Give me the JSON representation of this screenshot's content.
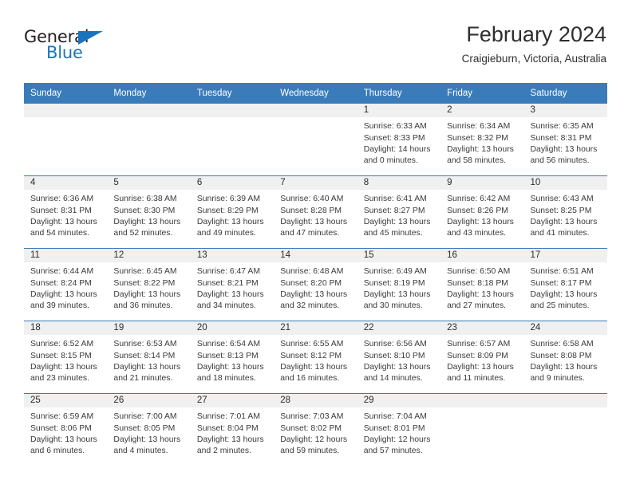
{
  "brand": {
    "name_part1": "General",
    "name_part2": "Blue",
    "triangle_color": "#1874bc"
  },
  "header": {
    "title": "February 2024",
    "subtitle": "Craigieburn, Victoria, Australia"
  },
  "theme": {
    "header_blue": "#3a7cba",
    "day_band_gray": "#f0f0f0",
    "text": "#2b2b2b"
  },
  "calendar": {
    "weekday_headers": [
      "Sunday",
      "Monday",
      "Tuesday",
      "Wednesday",
      "Thursday",
      "Friday",
      "Saturday"
    ],
    "weeks": [
      [
        {
          "day": "",
          "empty": true,
          "sunrise": "",
          "sunset": "",
          "daylight_line1": "",
          "daylight_line2": ""
        },
        {
          "day": "",
          "empty": true,
          "sunrise": "",
          "sunset": "",
          "daylight_line1": "",
          "daylight_line2": ""
        },
        {
          "day": "",
          "empty": true,
          "sunrise": "",
          "sunset": "",
          "daylight_line1": "",
          "daylight_line2": ""
        },
        {
          "day": "",
          "empty": true,
          "sunrise": "",
          "sunset": "",
          "daylight_line1": "",
          "daylight_line2": ""
        },
        {
          "day": "1",
          "empty": false,
          "sunrise": "Sunrise: 6:33 AM",
          "sunset": "Sunset: 8:33 PM",
          "daylight_line1": "Daylight: 14 hours",
          "daylight_line2": "and 0 minutes."
        },
        {
          "day": "2",
          "empty": false,
          "sunrise": "Sunrise: 6:34 AM",
          "sunset": "Sunset: 8:32 PM",
          "daylight_line1": "Daylight: 13 hours",
          "daylight_line2": "and 58 minutes."
        },
        {
          "day": "3",
          "empty": false,
          "sunrise": "Sunrise: 6:35 AM",
          "sunset": "Sunset: 8:31 PM",
          "daylight_line1": "Daylight: 13 hours",
          "daylight_line2": "and 56 minutes."
        }
      ],
      [
        {
          "day": "4",
          "empty": false,
          "sunrise": "Sunrise: 6:36 AM",
          "sunset": "Sunset: 8:31 PM",
          "daylight_line1": "Daylight: 13 hours",
          "daylight_line2": "and 54 minutes."
        },
        {
          "day": "5",
          "empty": false,
          "sunrise": "Sunrise: 6:38 AM",
          "sunset": "Sunset: 8:30 PM",
          "daylight_line1": "Daylight: 13 hours",
          "daylight_line2": "and 52 minutes."
        },
        {
          "day": "6",
          "empty": false,
          "sunrise": "Sunrise: 6:39 AM",
          "sunset": "Sunset: 8:29 PM",
          "daylight_line1": "Daylight: 13 hours",
          "daylight_line2": "and 49 minutes."
        },
        {
          "day": "7",
          "empty": false,
          "sunrise": "Sunrise: 6:40 AM",
          "sunset": "Sunset: 8:28 PM",
          "daylight_line1": "Daylight: 13 hours",
          "daylight_line2": "and 47 minutes."
        },
        {
          "day": "8",
          "empty": false,
          "sunrise": "Sunrise: 6:41 AM",
          "sunset": "Sunset: 8:27 PM",
          "daylight_line1": "Daylight: 13 hours",
          "daylight_line2": "and 45 minutes."
        },
        {
          "day": "9",
          "empty": false,
          "sunrise": "Sunrise: 6:42 AM",
          "sunset": "Sunset: 8:26 PM",
          "daylight_line1": "Daylight: 13 hours",
          "daylight_line2": "and 43 minutes."
        },
        {
          "day": "10",
          "empty": false,
          "sunrise": "Sunrise: 6:43 AM",
          "sunset": "Sunset: 8:25 PM",
          "daylight_line1": "Daylight: 13 hours",
          "daylight_line2": "and 41 minutes."
        }
      ],
      [
        {
          "day": "11",
          "empty": false,
          "sunrise": "Sunrise: 6:44 AM",
          "sunset": "Sunset: 8:24 PM",
          "daylight_line1": "Daylight: 13 hours",
          "daylight_line2": "and 39 minutes."
        },
        {
          "day": "12",
          "empty": false,
          "sunrise": "Sunrise: 6:45 AM",
          "sunset": "Sunset: 8:22 PM",
          "daylight_line1": "Daylight: 13 hours",
          "daylight_line2": "and 36 minutes."
        },
        {
          "day": "13",
          "empty": false,
          "sunrise": "Sunrise: 6:47 AM",
          "sunset": "Sunset: 8:21 PM",
          "daylight_line1": "Daylight: 13 hours",
          "daylight_line2": "and 34 minutes."
        },
        {
          "day": "14",
          "empty": false,
          "sunrise": "Sunrise: 6:48 AM",
          "sunset": "Sunset: 8:20 PM",
          "daylight_line1": "Daylight: 13 hours",
          "daylight_line2": "and 32 minutes."
        },
        {
          "day": "15",
          "empty": false,
          "sunrise": "Sunrise: 6:49 AM",
          "sunset": "Sunset: 8:19 PM",
          "daylight_line1": "Daylight: 13 hours",
          "daylight_line2": "and 30 minutes."
        },
        {
          "day": "16",
          "empty": false,
          "sunrise": "Sunrise: 6:50 AM",
          "sunset": "Sunset: 8:18 PM",
          "daylight_line1": "Daylight: 13 hours",
          "daylight_line2": "and 27 minutes."
        },
        {
          "day": "17",
          "empty": false,
          "sunrise": "Sunrise: 6:51 AM",
          "sunset": "Sunset: 8:17 PM",
          "daylight_line1": "Daylight: 13 hours",
          "daylight_line2": "and 25 minutes."
        }
      ],
      [
        {
          "day": "18",
          "empty": false,
          "sunrise": "Sunrise: 6:52 AM",
          "sunset": "Sunset: 8:15 PM",
          "daylight_line1": "Daylight: 13 hours",
          "daylight_line2": "and 23 minutes."
        },
        {
          "day": "19",
          "empty": false,
          "sunrise": "Sunrise: 6:53 AM",
          "sunset": "Sunset: 8:14 PM",
          "daylight_line1": "Daylight: 13 hours",
          "daylight_line2": "and 21 minutes."
        },
        {
          "day": "20",
          "empty": false,
          "sunrise": "Sunrise: 6:54 AM",
          "sunset": "Sunset: 8:13 PM",
          "daylight_line1": "Daylight: 13 hours",
          "daylight_line2": "and 18 minutes."
        },
        {
          "day": "21",
          "empty": false,
          "sunrise": "Sunrise: 6:55 AM",
          "sunset": "Sunset: 8:12 PM",
          "daylight_line1": "Daylight: 13 hours",
          "daylight_line2": "and 16 minutes."
        },
        {
          "day": "22",
          "empty": false,
          "sunrise": "Sunrise: 6:56 AM",
          "sunset": "Sunset: 8:10 PM",
          "daylight_line1": "Daylight: 13 hours",
          "daylight_line2": "and 14 minutes."
        },
        {
          "day": "23",
          "empty": false,
          "sunrise": "Sunrise: 6:57 AM",
          "sunset": "Sunset: 8:09 PM",
          "daylight_line1": "Daylight: 13 hours",
          "daylight_line2": "and 11 minutes."
        },
        {
          "day": "24",
          "empty": false,
          "sunrise": "Sunrise: 6:58 AM",
          "sunset": "Sunset: 8:08 PM",
          "daylight_line1": "Daylight: 13 hours",
          "daylight_line2": "and 9 minutes."
        }
      ],
      [
        {
          "day": "25",
          "empty": false,
          "sunrise": "Sunrise: 6:59 AM",
          "sunset": "Sunset: 8:06 PM",
          "daylight_line1": "Daylight: 13 hours",
          "daylight_line2": "and 6 minutes."
        },
        {
          "day": "26",
          "empty": false,
          "sunrise": "Sunrise: 7:00 AM",
          "sunset": "Sunset: 8:05 PM",
          "daylight_line1": "Daylight: 13 hours",
          "daylight_line2": "and 4 minutes."
        },
        {
          "day": "27",
          "empty": false,
          "sunrise": "Sunrise: 7:01 AM",
          "sunset": "Sunset: 8:04 PM",
          "daylight_line1": "Daylight: 13 hours",
          "daylight_line2": "and 2 minutes."
        },
        {
          "day": "28",
          "empty": false,
          "sunrise": "Sunrise: 7:03 AM",
          "sunset": "Sunset: 8:02 PM",
          "daylight_line1": "Daylight: 12 hours",
          "daylight_line2": "and 59 minutes."
        },
        {
          "day": "29",
          "empty": false,
          "sunrise": "Sunrise: 7:04 AM",
          "sunset": "Sunset: 8:01 PM",
          "daylight_line1": "Daylight: 12 hours",
          "daylight_line2": "and 57 minutes."
        },
        {
          "day": "",
          "empty": true,
          "sunrise": "",
          "sunset": "",
          "daylight_line1": "",
          "daylight_line2": ""
        },
        {
          "day": "",
          "empty": true,
          "sunrise": "",
          "sunset": "",
          "daylight_line1": "",
          "daylight_line2": ""
        }
      ]
    ]
  }
}
